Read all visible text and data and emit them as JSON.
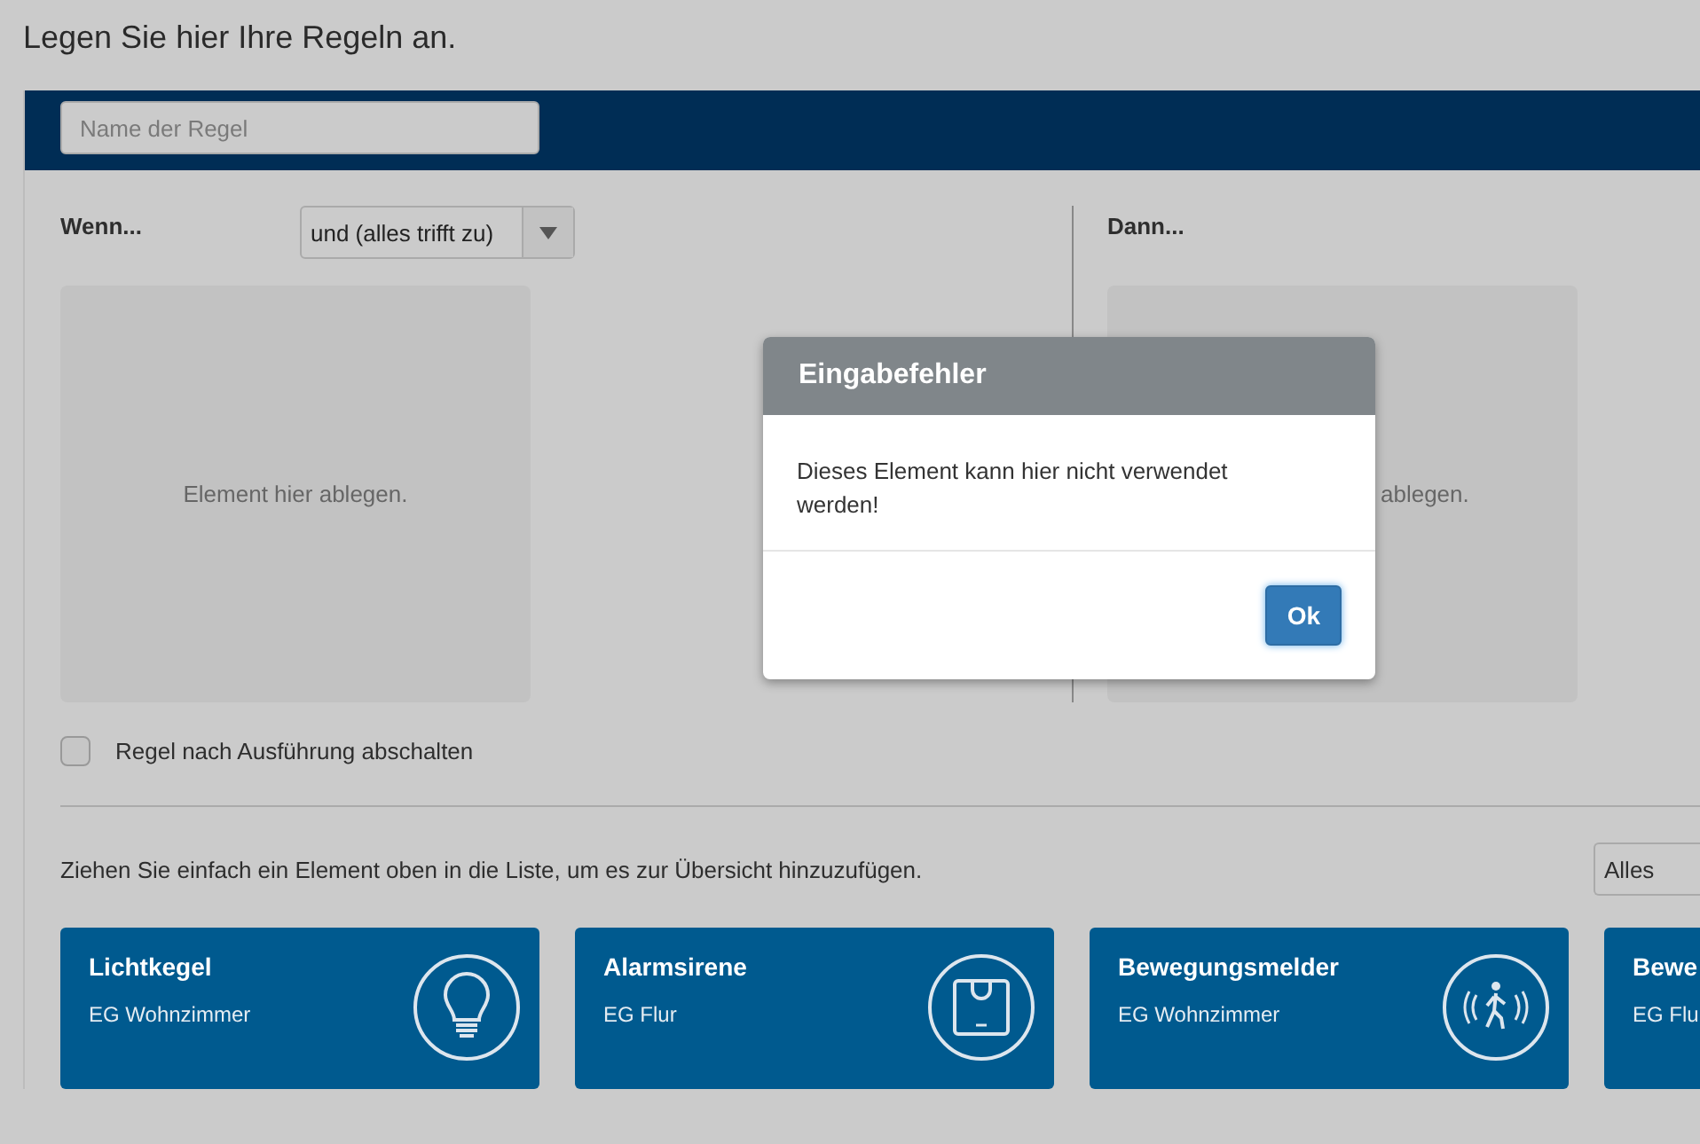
{
  "page_title": "Legen Sie hier Ihre Regeln an.",
  "rule_name": {
    "placeholder": "Name der Regel"
  },
  "if_section": {
    "label": "Wenn...",
    "operator": "und (alles trifft zu)",
    "dropzone": "Element hier ablegen."
  },
  "then_section": {
    "label": "Dann...",
    "dropzone": "ablegen."
  },
  "disable_after_run": {
    "label": "Regel nach Ausführung abschalten",
    "checked": false
  },
  "hint": "Ziehen Sie einfach ein Element oben in die Liste, um es zur Übersicht hinzuzufügen.",
  "filter": {
    "value": "Alles"
  },
  "elements": [
    {
      "title": "Lichtkegel",
      "room": "EG Wohnzimmer",
      "kind": "bulb"
    },
    {
      "title": "Alarmsirene",
      "room": "EG Flur",
      "kind": "siren"
    },
    {
      "title": "Bewegungsmelder",
      "room": "EG Wohnzimmer",
      "kind": "motion"
    },
    {
      "title": "Bewe",
      "room": "EG Flu",
      "kind": "none"
    }
  ],
  "dialog": {
    "title": "Eingabefehler",
    "message": "Dieses Element kann hier nicht verwendet werden!",
    "button": "Ok"
  }
}
